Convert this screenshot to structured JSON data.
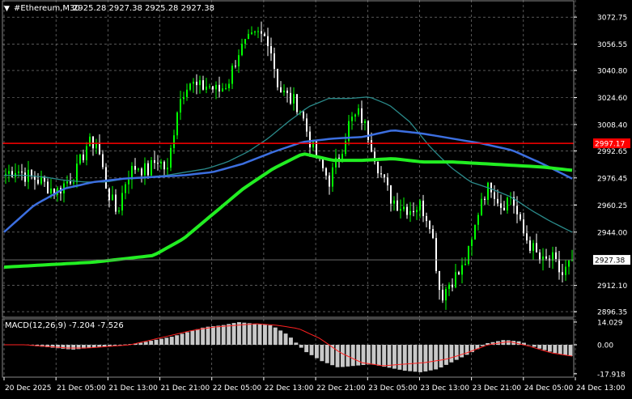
{
  "header": {
    "menu_glyph": "▼",
    "symbol_label": "#Ethereum,M30",
    "ohlc": "2925.28 2927.38 2925.28 2927.38"
  },
  "colors": {
    "background": "#000000",
    "grid": "#c8c8c8",
    "bull_candle": "#00ff00",
    "bear_candle": "#ffffff",
    "ma_fast": "#2a8a8a",
    "ma_mid": "#3c6fe0",
    "ma_slow": "#22ee22",
    "resistance_line": "#ff0000",
    "macd_hist": "#c8c8c8",
    "macd_signal": "#ff2020",
    "price_tag_bg": "#ffffff",
    "price_tag_text": "#000000"
  },
  "price_axis": {
    "labels": [
      "3072.75",
      "3056.55",
      "3040.80",
      "3024.60",
      "3008.40",
      "2992.65",
      "2976.45",
      "2960.25",
      "2944.00",
      "2912.10",
      "2896.35"
    ],
    "values": [
      3072.75,
      3056.55,
      3040.8,
      3024.6,
      3008.4,
      2992.65,
      2976.45,
      2960.25,
      2944.0,
      2912.1,
      2896.35
    ],
    "range": [
      2893,
      3083
    ]
  },
  "price_tags": {
    "resistance": {
      "label": "2997.17",
      "value": 2997.17
    },
    "current": {
      "label": "2927.38",
      "value": 2927.38
    }
  },
  "time_axis": {
    "labels": [
      "20 Dec 2025",
      "21 Dec 05:00",
      "21 Dec 13:00",
      "21 Dec 21:00",
      "22 Dec 05:00",
      "22 Dec 13:00",
      "22 Dec 21:00",
      "23 Dec 05:00",
      "23 Dec 13:00",
      "23 Dec 21:00",
      "24 Dec 05:00",
      "24 Dec 13:00"
    ]
  },
  "macd": {
    "label": "MACD(12,26,9) -7.204 -7.526",
    "axis_labels": [
      "14.029",
      "0.00",
      "-17.918"
    ],
    "axis_values": [
      14.029,
      0.0,
      -17.918
    ],
    "range": [
      -20,
      16
    ]
  },
  "chart_data": {
    "type": "candlestick",
    "symbol": "#Ethereum",
    "timeframe": "M30",
    "close_path": [
      2979,
      2982,
      2978,
      2976,
      2972,
      2968,
      2974,
      2980,
      2996,
      2998,
      2970,
      2955,
      2978,
      2984,
      2980,
      2988,
      2980,
      3020,
      3035,
      3030,
      3032,
      3028,
      3034,
      3052,
      3058,
      3062,
      3060,
      3030,
      3024,
      3020,
      3000,
      2985,
      2975,
      2990,
      3010,
      3015,
      3000,
      2980,
      2965,
      2960,
      2958,
      2960,
      2950,
      2905,
      2915,
      2920,
      2935,
      2965,
      2972,
      2960,
      2966,
      2945,
      2935,
      2925,
      2928,
      2918,
      2927
    ],
    "ma_fast": [
      2978,
      2978,
      2977,
      2975,
      2974,
      2974,
      2976,
      2977,
      2978,
      2980,
      2982,
      2986,
      2992,
      3000,
      3010,
      3019,
      3024,
      3024,
      3025,
      3020,
      3010,
      2995,
      2983,
      2974,
      2970,
      2965,
      2957,
      2950,
      2944
    ],
    "ma_mid": [
      2944,
      2960,
      2970,
      2974,
      2976,
      2977,
      2978,
      2980,
      2985,
      2992,
      2998,
      3000,
      3001,
      3005,
      3003,
      3000,
      2997,
      2993,
      2985,
      2976
    ],
    "ma_slow": [
      2923,
      2924,
      2925,
      2926,
      2928,
      2930,
      2940,
      2955,
      2970,
      2982,
      2991,
      2987,
      2987,
      2988,
      2986,
      2986,
      2985,
      2984,
      2983,
      2981
    ],
    "resistance": 2997.17,
    "last": 2927.38,
    "macd_hist": [
      0,
      0,
      -1,
      -2,
      -3,
      -2,
      -1,
      0,
      1,
      3,
      5,
      8,
      11,
      12,
      14,
      13,
      12,
      6,
      -4,
      -10,
      -14,
      -13,
      -12,
      -14,
      -16,
      -17,
      -15,
      -10,
      -5,
      1,
      3,
      2,
      -2,
      -5,
      -7
    ],
    "macd_signal": [
      0,
      0,
      -1,
      -2,
      -2,
      -1,
      0,
      3,
      6,
      9,
      11,
      12,
      13,
      12,
      10,
      4,
      -5,
      -11,
      -13,
      -12,
      -11,
      -9,
      -5,
      0,
      2,
      -1,
      -5,
      -7
    ]
  }
}
